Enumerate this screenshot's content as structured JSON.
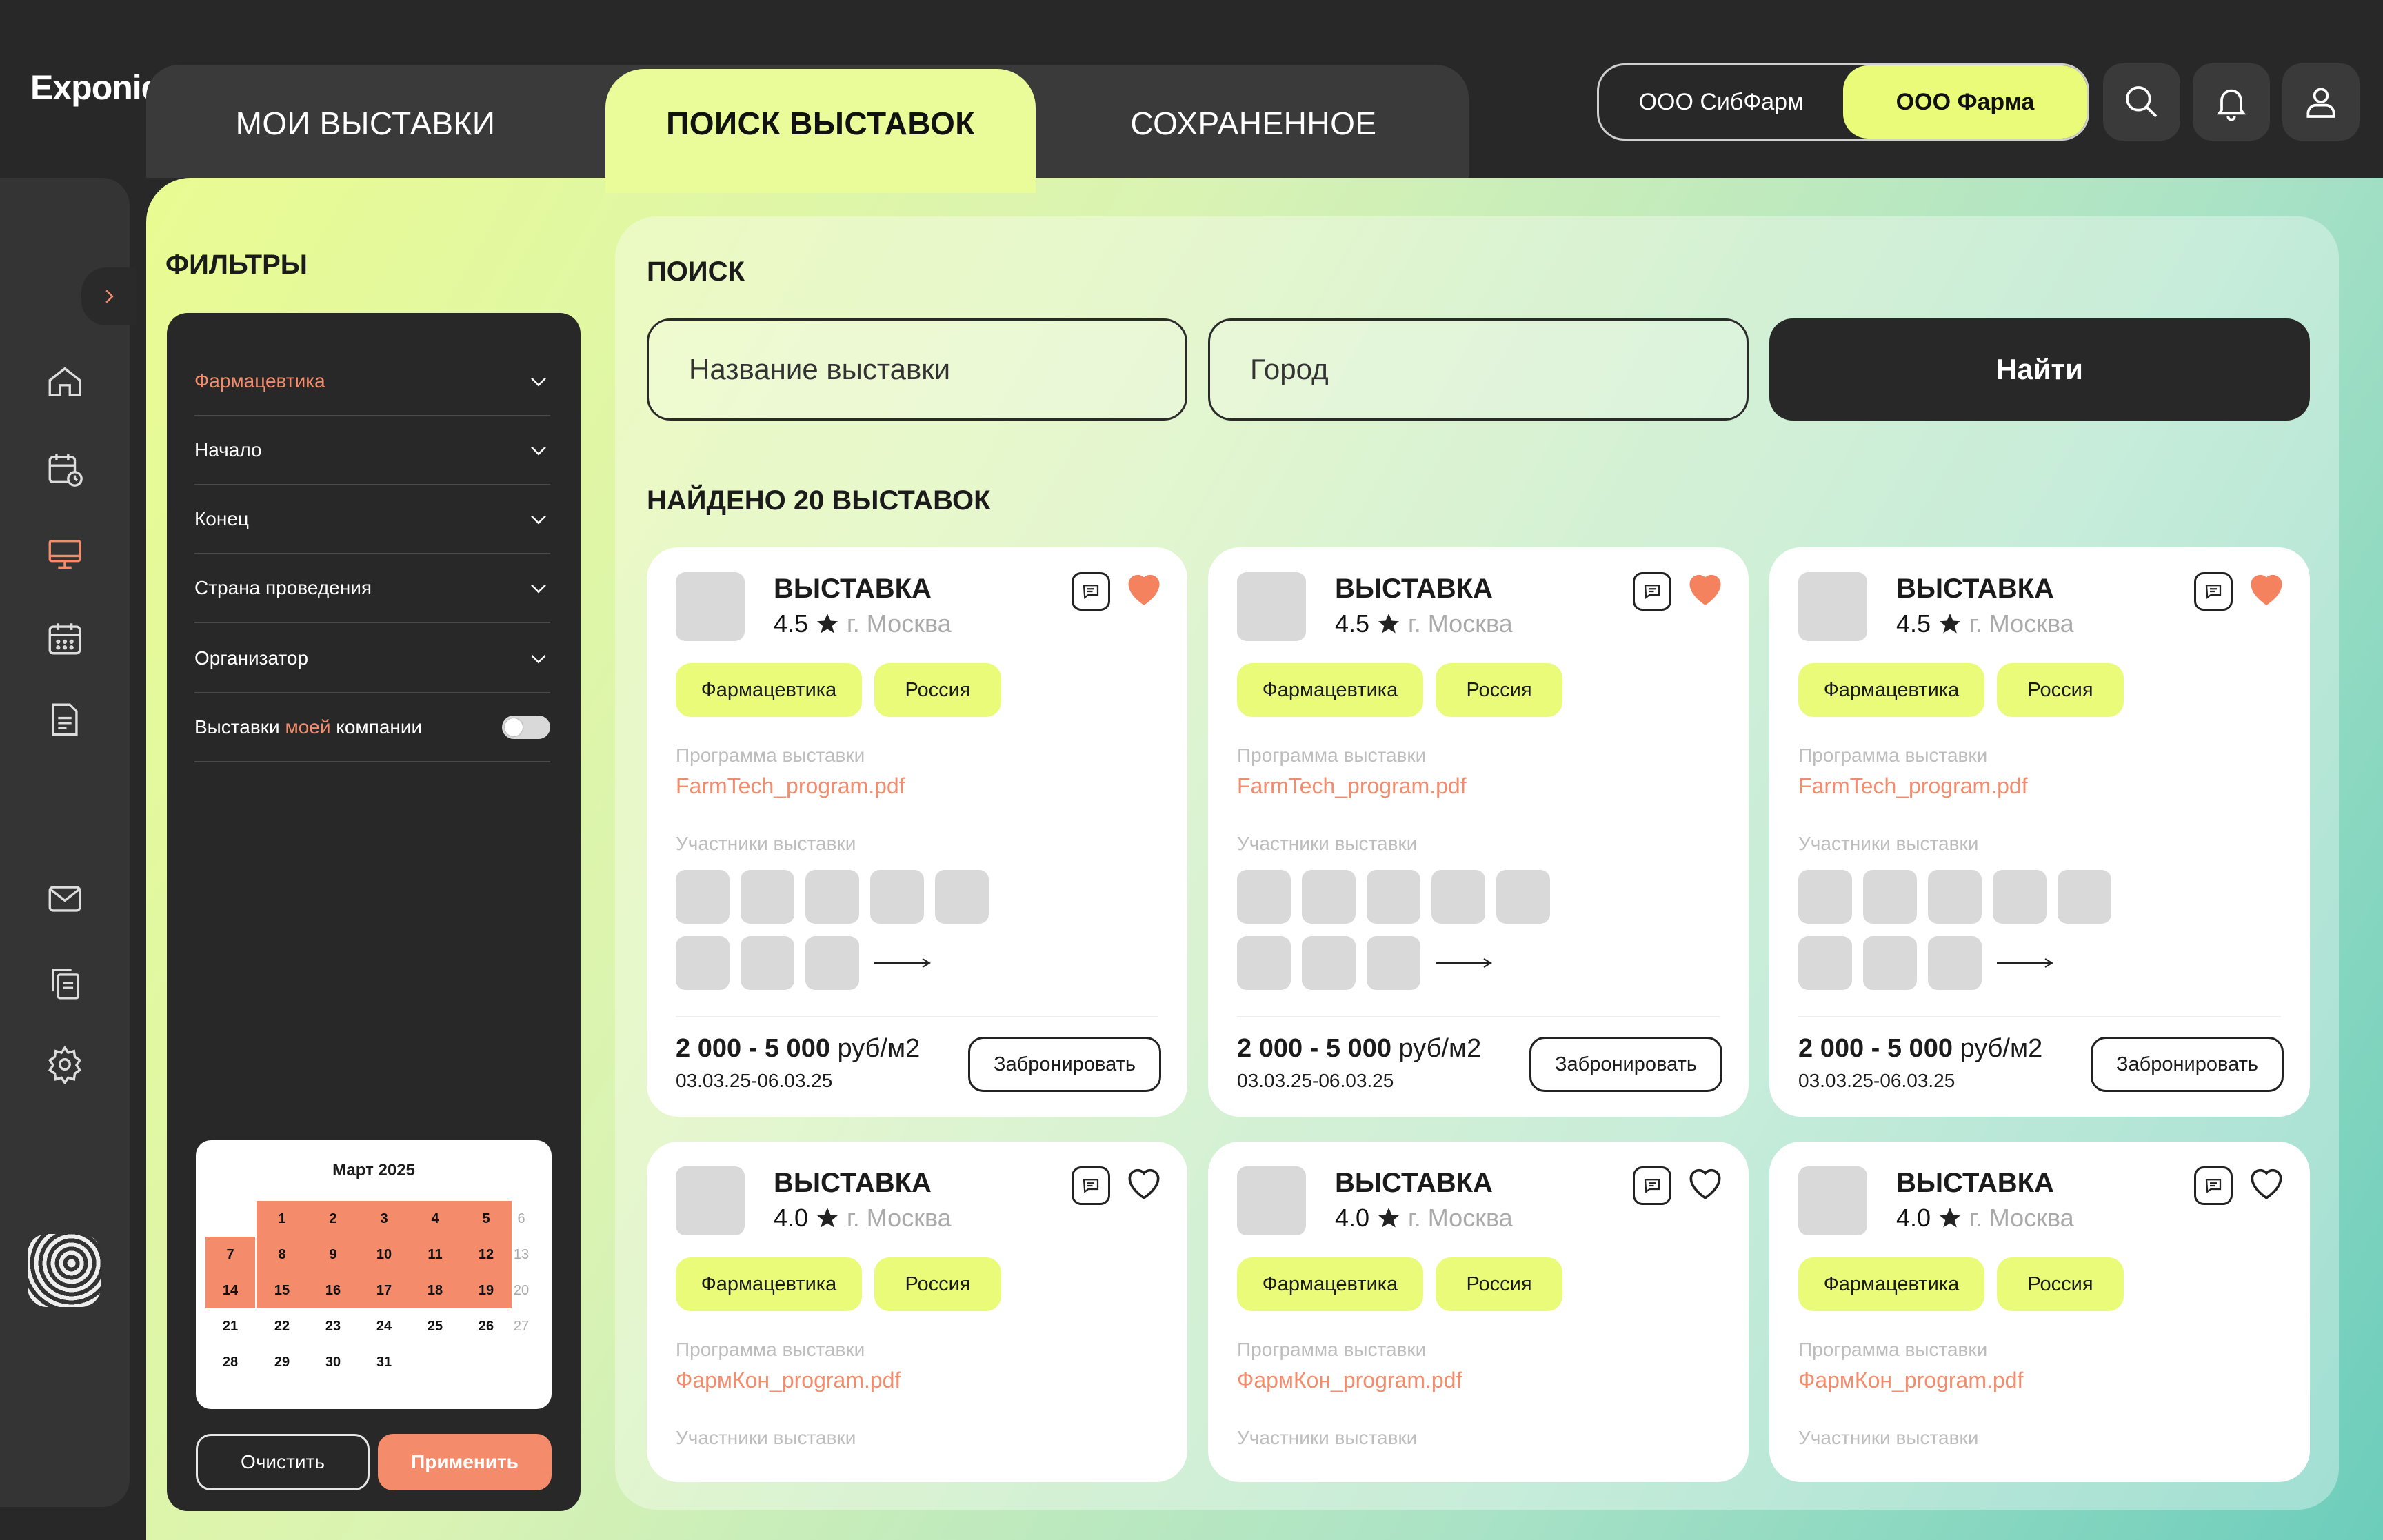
{
  "app": {
    "logo": "Exponiel"
  },
  "tabs": [
    {
      "label": "МОИ ВЫСТАВКИ"
    },
    {
      "label": "ПОИСК ВЫСТАВОК"
    },
    {
      "label": "СОХРАНЕННОЕ"
    }
  ],
  "company_switch": {
    "options": [
      "ООО СибФарм",
      "ООО Фарма"
    ],
    "active": "ООО Фарма"
  },
  "top_icons": [
    "search-icon",
    "bell-icon",
    "user-icon"
  ],
  "sidebar": {
    "icons": [
      "home-icon",
      "calendar-clock-icon",
      "monitor-icon",
      "calendar-grid-icon",
      "document-icon",
      "mail-icon",
      "copy-icon",
      "settings-icon"
    ],
    "active": "monitor-icon"
  },
  "filters": {
    "title": "ФИЛЬТРЫ",
    "rows": [
      {
        "label": "Фармацевтика"
      },
      {
        "label": "Начало"
      },
      {
        "label": "Конец"
      },
      {
        "label": "Страна проведения"
      },
      {
        "label": "Организатор"
      }
    ],
    "company_toggle": {
      "pre": "Выставки ",
      "hl": "моей",
      "post": " компании"
    },
    "calendar": {
      "title": "Март 2025",
      "weeks": [
        [
          "",
          "1",
          "2",
          "3",
          "4",
          "5",
          "6"
        ],
        [
          "7",
          "8",
          "9",
          "10",
          "11",
          "12",
          "13"
        ],
        [
          "14",
          "15",
          "16",
          "17",
          "18",
          "19",
          "20"
        ],
        [
          "21",
          "22",
          "23",
          "24",
          "25",
          "26",
          "27"
        ],
        [
          "28",
          "29",
          "30",
          "31",
          "",
          "",
          ""
        ]
      ]
    },
    "clear_label": "Очистить",
    "apply_label": "Применить"
  },
  "search": {
    "title": "ПОИСК",
    "name_placeholder": "Название выставки",
    "city_placeholder": "Город",
    "find_label": "Найти",
    "found": "НАЙДЕНО 20 ВЫСТАВОК"
  },
  "colors": {
    "accent": "#f48c6c",
    "lime": "#eafb7a",
    "dark": "#282828"
  },
  "cards": [
    {
      "name": "ВЫСТАВКА",
      "rating": "4.5",
      "city": "г. Москва",
      "tags": [
        "Фармацевтика",
        "Россия"
      ],
      "program_label": "Программа выставки",
      "file": "FarmTech_program.pdf",
      "participants_label": "Участники выставки",
      "price_range": "2 000 - 5 000",
      "price_unit": " руб/м2",
      "dates": "03.03.25-06.03.25",
      "book_label": "Забронировать",
      "favorite": true
    },
    {
      "name": "ВЫСТАВКА",
      "rating": "4.5",
      "city": "г. Москва",
      "tags": [
        "Фармацевтика",
        "Россия"
      ],
      "program_label": "Программа выставки",
      "file": "FarmTech_program.pdf",
      "participants_label": "Участники выставки",
      "price_range": "2 000 - 5 000",
      "price_unit": " руб/м2",
      "dates": "03.03.25-06.03.25",
      "book_label": "Забронировать",
      "favorite": true
    },
    {
      "name": "ВЫСТАВКА",
      "rating": "4.5",
      "city": "г. Москва",
      "tags": [
        "Фармацевтика",
        "Россия"
      ],
      "program_label": "Программа выставки",
      "file": "FarmTech_program.pdf",
      "participants_label": "Участники выставки",
      "price_range": "2 000 - 5 000",
      "price_unit": " руб/м2",
      "dates": "03.03.25-06.03.25",
      "book_label": "Забронировать",
      "favorite": true
    },
    {
      "name": "ВЫСТАВКА",
      "rating": "4.0",
      "city": "г. Москва",
      "tags": [
        "Фармацевтика",
        "Россия"
      ],
      "program_label": "Программа выставки",
      "file": "ФармКон_program.pdf",
      "participants_label": "Участники выставки",
      "favorite": false
    },
    {
      "name": "ВЫСТАВКА",
      "rating": "4.0",
      "city": "г. Москва",
      "tags": [
        "Фармацевтика",
        "Россия"
      ],
      "program_label": "Программа выставки",
      "file": "ФармКон_program.pdf",
      "participants_label": "Участники выставки",
      "favorite": false
    },
    {
      "name": "ВЫСТАВКА",
      "rating": "4.0",
      "city": "г. Москва",
      "tags": [
        "Фармацевтика",
        "Россия"
      ],
      "program_label": "Программа выставки",
      "file": "ФармКон_program.pdf",
      "participants_label": "Участники выставки",
      "favorite": false
    }
  ]
}
